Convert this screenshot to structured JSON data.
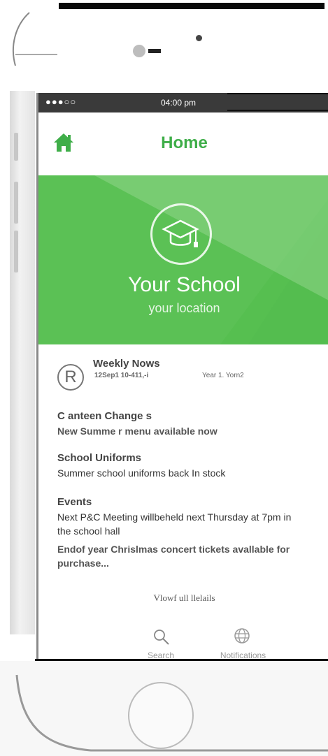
{
  "status_bar": {
    "signal": "●●●○○",
    "time": "04:00 pm"
  },
  "header": {
    "title": "Home",
    "home_icon": "home-icon"
  },
  "banner": {
    "icon": "graduation-cap-icon",
    "school_name": "Your School",
    "location": "your location",
    "color": "#54bd4f"
  },
  "news": {
    "icon_letter": "R",
    "title": "Weekly Nows",
    "date_line": "12Sep1  10-411,-i",
    "year_line": "Year 1. Yorn2",
    "sections": [
      {
        "title": "C anteen Change s",
        "body": "New Summe r menu available now"
      },
      {
        "title": "School Uniforms",
        "body": "Summer school uniforms back In stock"
      },
      {
        "title": "Events",
        "body": "Next P&C Meeting willbeheld next Thursday at 7pm in the school hall",
        "body2": "Endof year Chrislmas concert tickets avallable for purchase..."
      }
    ],
    "view_details": "Vlowf ull llelails"
  },
  "tabs": [
    {
      "label": "Search",
      "icon": "search-icon"
    },
    {
      "label": "Notifications",
      "icon": "globe-icon"
    }
  ],
  "accent_color": "#3fae49"
}
